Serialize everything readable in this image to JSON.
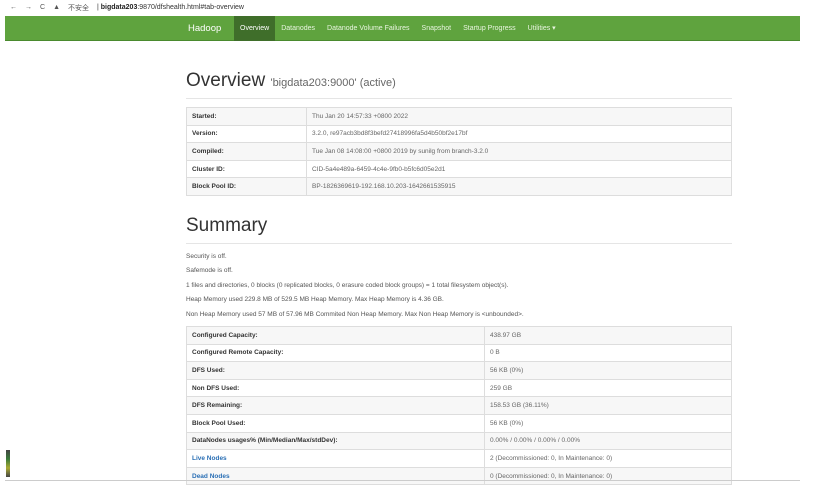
{
  "browser": {
    "insecure": "不安全",
    "host": "bigdata203",
    "url_rest": ":9870/dfshealth.html#tab-overview"
  },
  "nav": {
    "brand": "Hadoop",
    "items": [
      "Overview",
      "Datanodes",
      "Datanode Volume Failures",
      "Snapshot",
      "Startup Progress",
      "Utilities ▾"
    ]
  },
  "overview": {
    "title": "Overview",
    "subtitle": "'bigdata203:9000' (active)",
    "rows": [
      [
        "Started:",
        "Thu Jan 20 14:57:33 +0800 2022"
      ],
      [
        "Version:",
        "3.2.0, re97acb3bd8f3befd27418996fa5d4b50bf2e17bf"
      ],
      [
        "Compiled:",
        "Tue Jan 08 14:08:00 +0800 2019 by sunilg from branch-3.2.0"
      ],
      [
        "Cluster ID:",
        "CID-5a4e489a-6459-4c4e-9fb0-b5fc6d05e2d1"
      ],
      [
        "Block Pool ID:",
        "BP-1826369619-192.168.10.203-1642661535915"
      ]
    ]
  },
  "summary": {
    "title": "Summary",
    "lines": [
      "Security is off.",
      "Safemode is off.",
      "1 files and directories, 0 blocks (0 replicated blocks, 0 erasure coded block groups) = 1 total filesystem object(s).",
      "Heap Memory used 229.8 MB of 529.5 MB Heap Memory. Max Heap Memory is 4.36 GB.",
      "Non Heap Memory used 57 MB of 57.96 MB Commited Non Heap Memory. Max Non Heap Memory is <unbounded>."
    ],
    "rows": [
      [
        "Configured Capacity:",
        "438.97 GB"
      ],
      [
        "Configured Remote Capacity:",
        "0 B"
      ],
      [
        "DFS Used:",
        "56 KB (0%)"
      ],
      [
        "Non DFS Used:",
        "259 GB"
      ],
      [
        "DFS Remaining:",
        "158.53 GB (36.11%)"
      ],
      [
        "Block Pool Used:",
        "56 KB (0%)"
      ],
      [
        "DataNodes usages% (Min/Median/Max/stdDev):",
        "0.00% / 0.00% / 0.00% / 0.00%"
      ],
      [
        "Live Nodes",
        "2 (Decommissioned: 0, In Maintenance: 0)"
      ],
      [
        "Dead Nodes",
        "0 (Decommissioned: 0, In Maintenance: 0)"
      ]
    ]
  }
}
